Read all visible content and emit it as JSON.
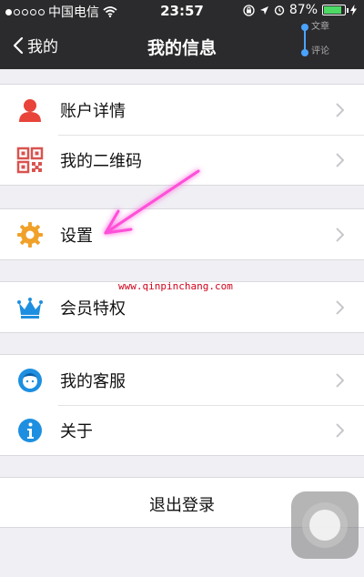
{
  "status_bar": {
    "carrier": "中国电信",
    "time": "23:57",
    "battery_percent": "87%",
    "battery_level": 0.87
  },
  "nav": {
    "back_label": "我的",
    "title": "我的信息",
    "side_labels": [
      "文章",
      "评论"
    ]
  },
  "groups": [
    {
      "items": [
        {
          "label": "账户详情",
          "icon": "user-icon"
        },
        {
          "label": "我的二维码",
          "icon": "qr-code-icon"
        }
      ]
    },
    {
      "items": [
        {
          "label": "设置",
          "icon": "gear-icon"
        }
      ]
    },
    {
      "items": [
        {
          "label": "会员特权",
          "icon": "crown-icon"
        }
      ]
    },
    {
      "items": [
        {
          "label": "我的客服",
          "icon": "customer-service-icon"
        },
        {
          "label": "关于",
          "icon": "info-icon"
        }
      ]
    }
  ],
  "logout_label": "退出登录",
  "watermark": "www.qinpinchang.com",
  "colors": {
    "nav_bg": "#2b2b2d",
    "page_bg": "#efeff4",
    "user_icon": "#e8443a",
    "gear_icon": "#f0a12a",
    "crown_icon": "#1e8fe0",
    "info_icon": "#1e8fe0",
    "battery": "#4cd964",
    "annotation_arrow": "#ff4fd8"
  }
}
